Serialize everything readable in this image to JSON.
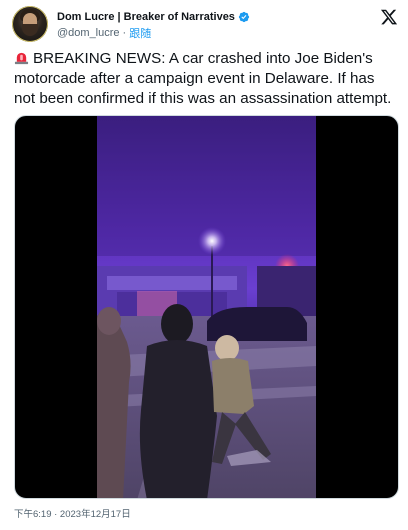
{
  "author": {
    "display_name": "Dom Lucre | Breaker of Narratives",
    "handle": "@dom_lucre",
    "separator": "·",
    "follow_label": "跟随",
    "verified_color": "#1d9bf0"
  },
  "tweet": {
    "text": "BREAKING NEWS: A car crashed into Joe Biden's motorcade after a campaign event in Delaware. If has not been confirmed if this was an assassination attempt."
  },
  "meta": {
    "timestamp": "下午6:19 · 2023年12月17日"
  },
  "icons": {
    "verified": "verified-badge-icon",
    "platform": "x-logo-icon",
    "siren": "rotating-light-icon"
  },
  "colors": {
    "accent": "#1d9bf0",
    "text": "#0f1419",
    "muted": "#536471",
    "video_tint": "#5b2fb8"
  }
}
